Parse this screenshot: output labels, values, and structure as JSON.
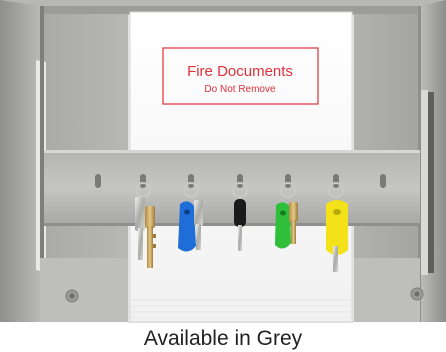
{
  "document_label": {
    "title": "Fire Documents",
    "subtitle": "Do Not Remove"
  },
  "caption": "Available in Grey",
  "colors": {
    "cabinet_grey": "#c9c9c7",
    "label_red": "#e0303a",
    "tag_blue": "#1f6ed8",
    "tag_black": "#1a1a1a",
    "tag_green": "#2fbf3a",
    "tag_yellow": "#f3e21a"
  },
  "keys": [
    {
      "tag": "none"
    },
    {
      "tag": "blue"
    },
    {
      "tag": "black"
    },
    {
      "tag": "green"
    },
    {
      "tag": "yellow"
    }
  ]
}
